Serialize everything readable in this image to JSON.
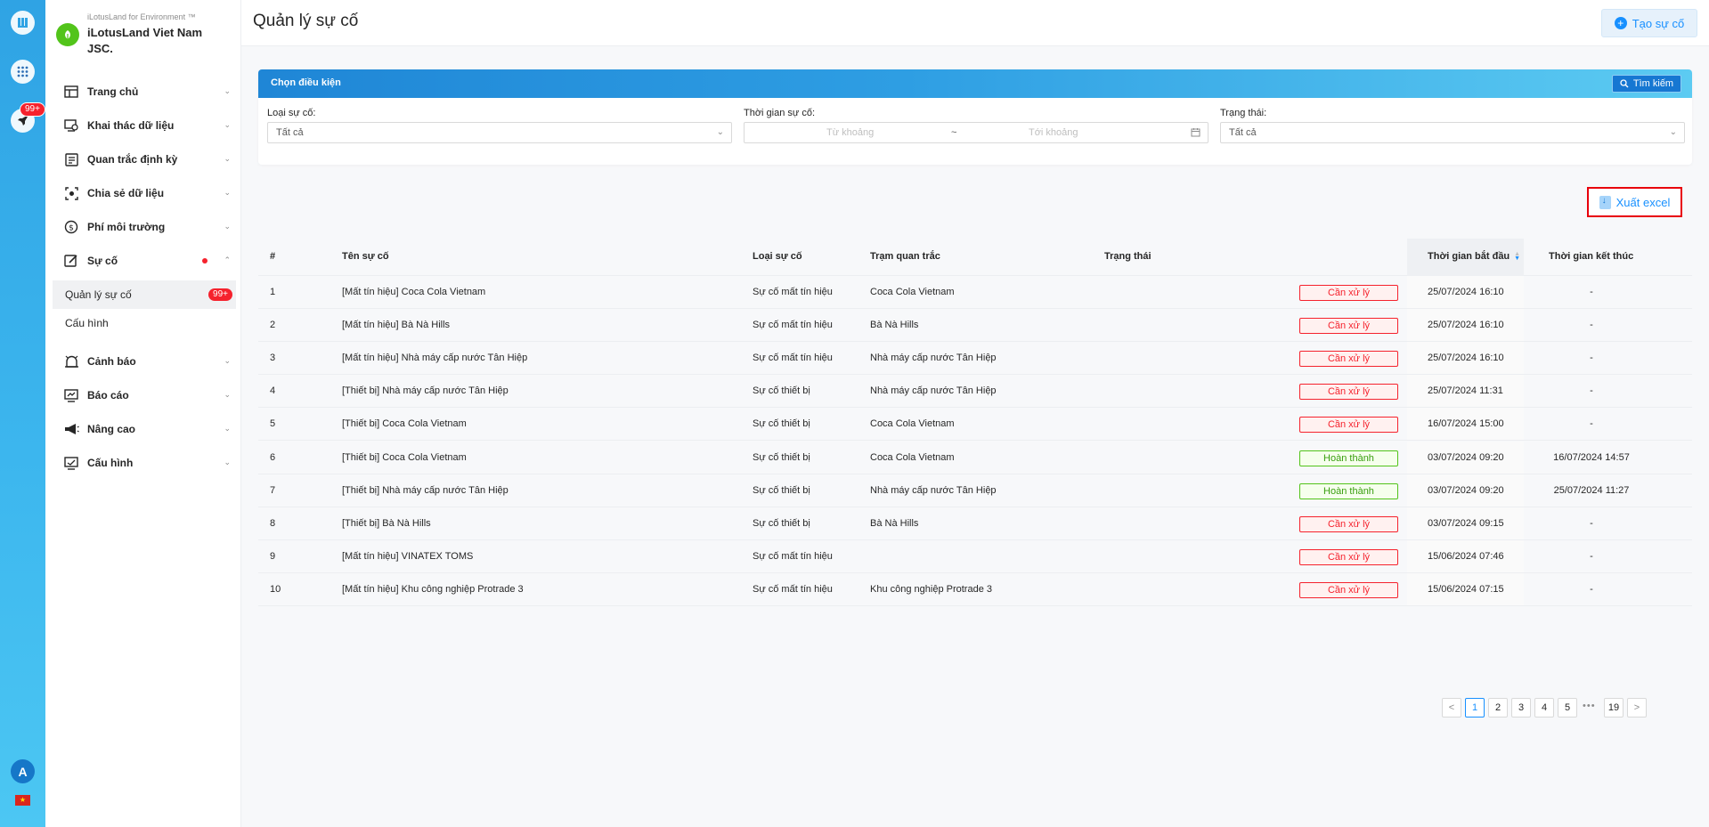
{
  "rail": {
    "badge": "99+",
    "avatar_letter": "A",
    "flag_star": "★"
  },
  "brand": {
    "subtitle": "iLotusLand for Environment ™",
    "name": "iLotusLand Viet Nam JSC."
  },
  "sidebar": {
    "items": [
      {
        "label": "Trang chủ",
        "icon": "home-layout-icon"
      },
      {
        "label": "Khai thác dữ liệu",
        "icon": "data-mining-icon"
      },
      {
        "label": "Quan trắc định kỳ",
        "icon": "periodic-monitoring-icon"
      },
      {
        "label": "Chia sẻ dữ liệu",
        "icon": "share-data-icon"
      },
      {
        "label": "Phí môi trường",
        "icon": "fee-icon"
      },
      {
        "label": "Sự cố",
        "icon": "incident-icon"
      },
      {
        "label": "Cảnh báo",
        "icon": "alarm-icon"
      },
      {
        "label": "Báo cáo",
        "icon": "report-icon"
      },
      {
        "label": "Nâng cao",
        "icon": "megaphone-icon"
      },
      {
        "label": "Cấu hình",
        "icon": "config-icon"
      }
    ],
    "sub_items": [
      {
        "label": "Quản lý sự cố",
        "badge": "99+"
      },
      {
        "label": "Cấu hình"
      }
    ]
  },
  "header": {
    "title": "Quản lý sự cố",
    "create_label": "Tạo sự cố"
  },
  "filter": {
    "title": "Chọn điều kiện",
    "search_label": "Tìm kiếm",
    "type_label": "Loại sự cố:",
    "type_value": "Tất cả",
    "time_label": "Thời gian sự cố:",
    "time_from_placeholder": "Từ khoảng",
    "time_separator": "~",
    "time_to_placeholder": "Tới khoảng",
    "status_label": "Trạng thái:",
    "status_value": "Tất cả"
  },
  "export_label": "Xuất excel",
  "table": {
    "columns": [
      "#",
      "Tên sự cố",
      "Loại sự cố",
      "Trạm quan trắc",
      "Trạng thái",
      "Thời gian bắt đầu",
      "Thời gian kết thúc"
    ],
    "rows": [
      {
        "no": "1",
        "name": "[Mất tín hiệu] Coca Cola Vietnam",
        "type": "Sự cố mất tín hiệu",
        "station": "Coca Cola Vietnam",
        "status": "Cần xử lý",
        "status_kind": "pending",
        "start": "25/07/2024 16:10",
        "end": "-"
      },
      {
        "no": "2",
        "name": "[Mất tín hiệu] Bà Nà Hills",
        "type": "Sự cố mất tín hiệu",
        "station": "Bà Nà Hills",
        "status": "Cần xử lý",
        "status_kind": "pending",
        "start": "25/07/2024 16:10",
        "end": "-"
      },
      {
        "no": "3",
        "name": "[Mất tín hiệu] Nhà máy cấp nước Tân Hiệp",
        "type": "Sự cố mất tín hiệu",
        "station": "Nhà máy cấp nước Tân Hiệp",
        "status": "Cần xử lý",
        "status_kind": "pending",
        "start": "25/07/2024 16:10",
        "end": "-"
      },
      {
        "no": "4",
        "name": "[Thiết bị] Nhà máy cấp nước Tân Hiệp",
        "type": "Sự cố thiết bị",
        "station": "Nhà máy cấp nước Tân Hiệp",
        "status": "Cần xử lý",
        "status_kind": "pending",
        "start": "25/07/2024 11:31",
        "end": "-"
      },
      {
        "no": "5",
        "name": "[Thiết bị] Coca Cola Vietnam",
        "type": "Sự cố thiết bị",
        "station": "Coca Cola Vietnam",
        "status": "Cần xử lý",
        "status_kind": "pending",
        "start": "16/07/2024 15:00",
        "end": "-"
      },
      {
        "no": "6",
        "name": "[Thiết bị] Coca Cola Vietnam",
        "type": "Sự cố thiết bị",
        "station": "Coca Cola Vietnam",
        "status": "Hoàn thành",
        "status_kind": "done",
        "start": "03/07/2024 09:20",
        "end": "16/07/2024 14:57"
      },
      {
        "no": "7",
        "name": "[Thiết bị] Nhà máy cấp nước Tân Hiệp",
        "type": "Sự cố thiết bị",
        "station": "Nhà máy cấp nước Tân Hiệp",
        "status": "Hoàn thành",
        "status_kind": "done",
        "start": "03/07/2024 09:20",
        "end": "25/07/2024 11:27"
      },
      {
        "no": "8",
        "name": "[Thiết bị] Bà Nà Hills",
        "type": "Sự cố thiết bị",
        "station": "Bà Nà Hills",
        "status": "Cần xử lý",
        "status_kind": "pending",
        "start": "03/07/2024 09:15",
        "end": "-"
      },
      {
        "no": "9",
        "name": "[Mất tín hiệu] VINATEX TOMS",
        "type": "Sự cố mất tín hiệu",
        "station": "",
        "status": "Cần xử lý",
        "status_kind": "pending",
        "start": "15/06/2024 07:46",
        "end": "-"
      },
      {
        "no": "10",
        "name": "[Mất tín hiệu] Khu công nghiệp Protrade 3",
        "type": "Sự cố mất tín hiệu",
        "station": "Khu công nghiệp Protrade 3",
        "status": "Cần xử lý",
        "status_kind": "pending",
        "start": "15/06/2024 07:15",
        "end": "-"
      }
    ]
  },
  "pagination": {
    "prev": "<",
    "pages": [
      "1",
      "2",
      "3",
      "4",
      "5"
    ],
    "current": "1",
    "ellipsis": "•••",
    "last": "19",
    "next": ">"
  },
  "colors": {
    "accent": "#1890ff",
    "danger": "#f5222d",
    "success": "#52c41a",
    "rail": "#2fa3e4"
  }
}
